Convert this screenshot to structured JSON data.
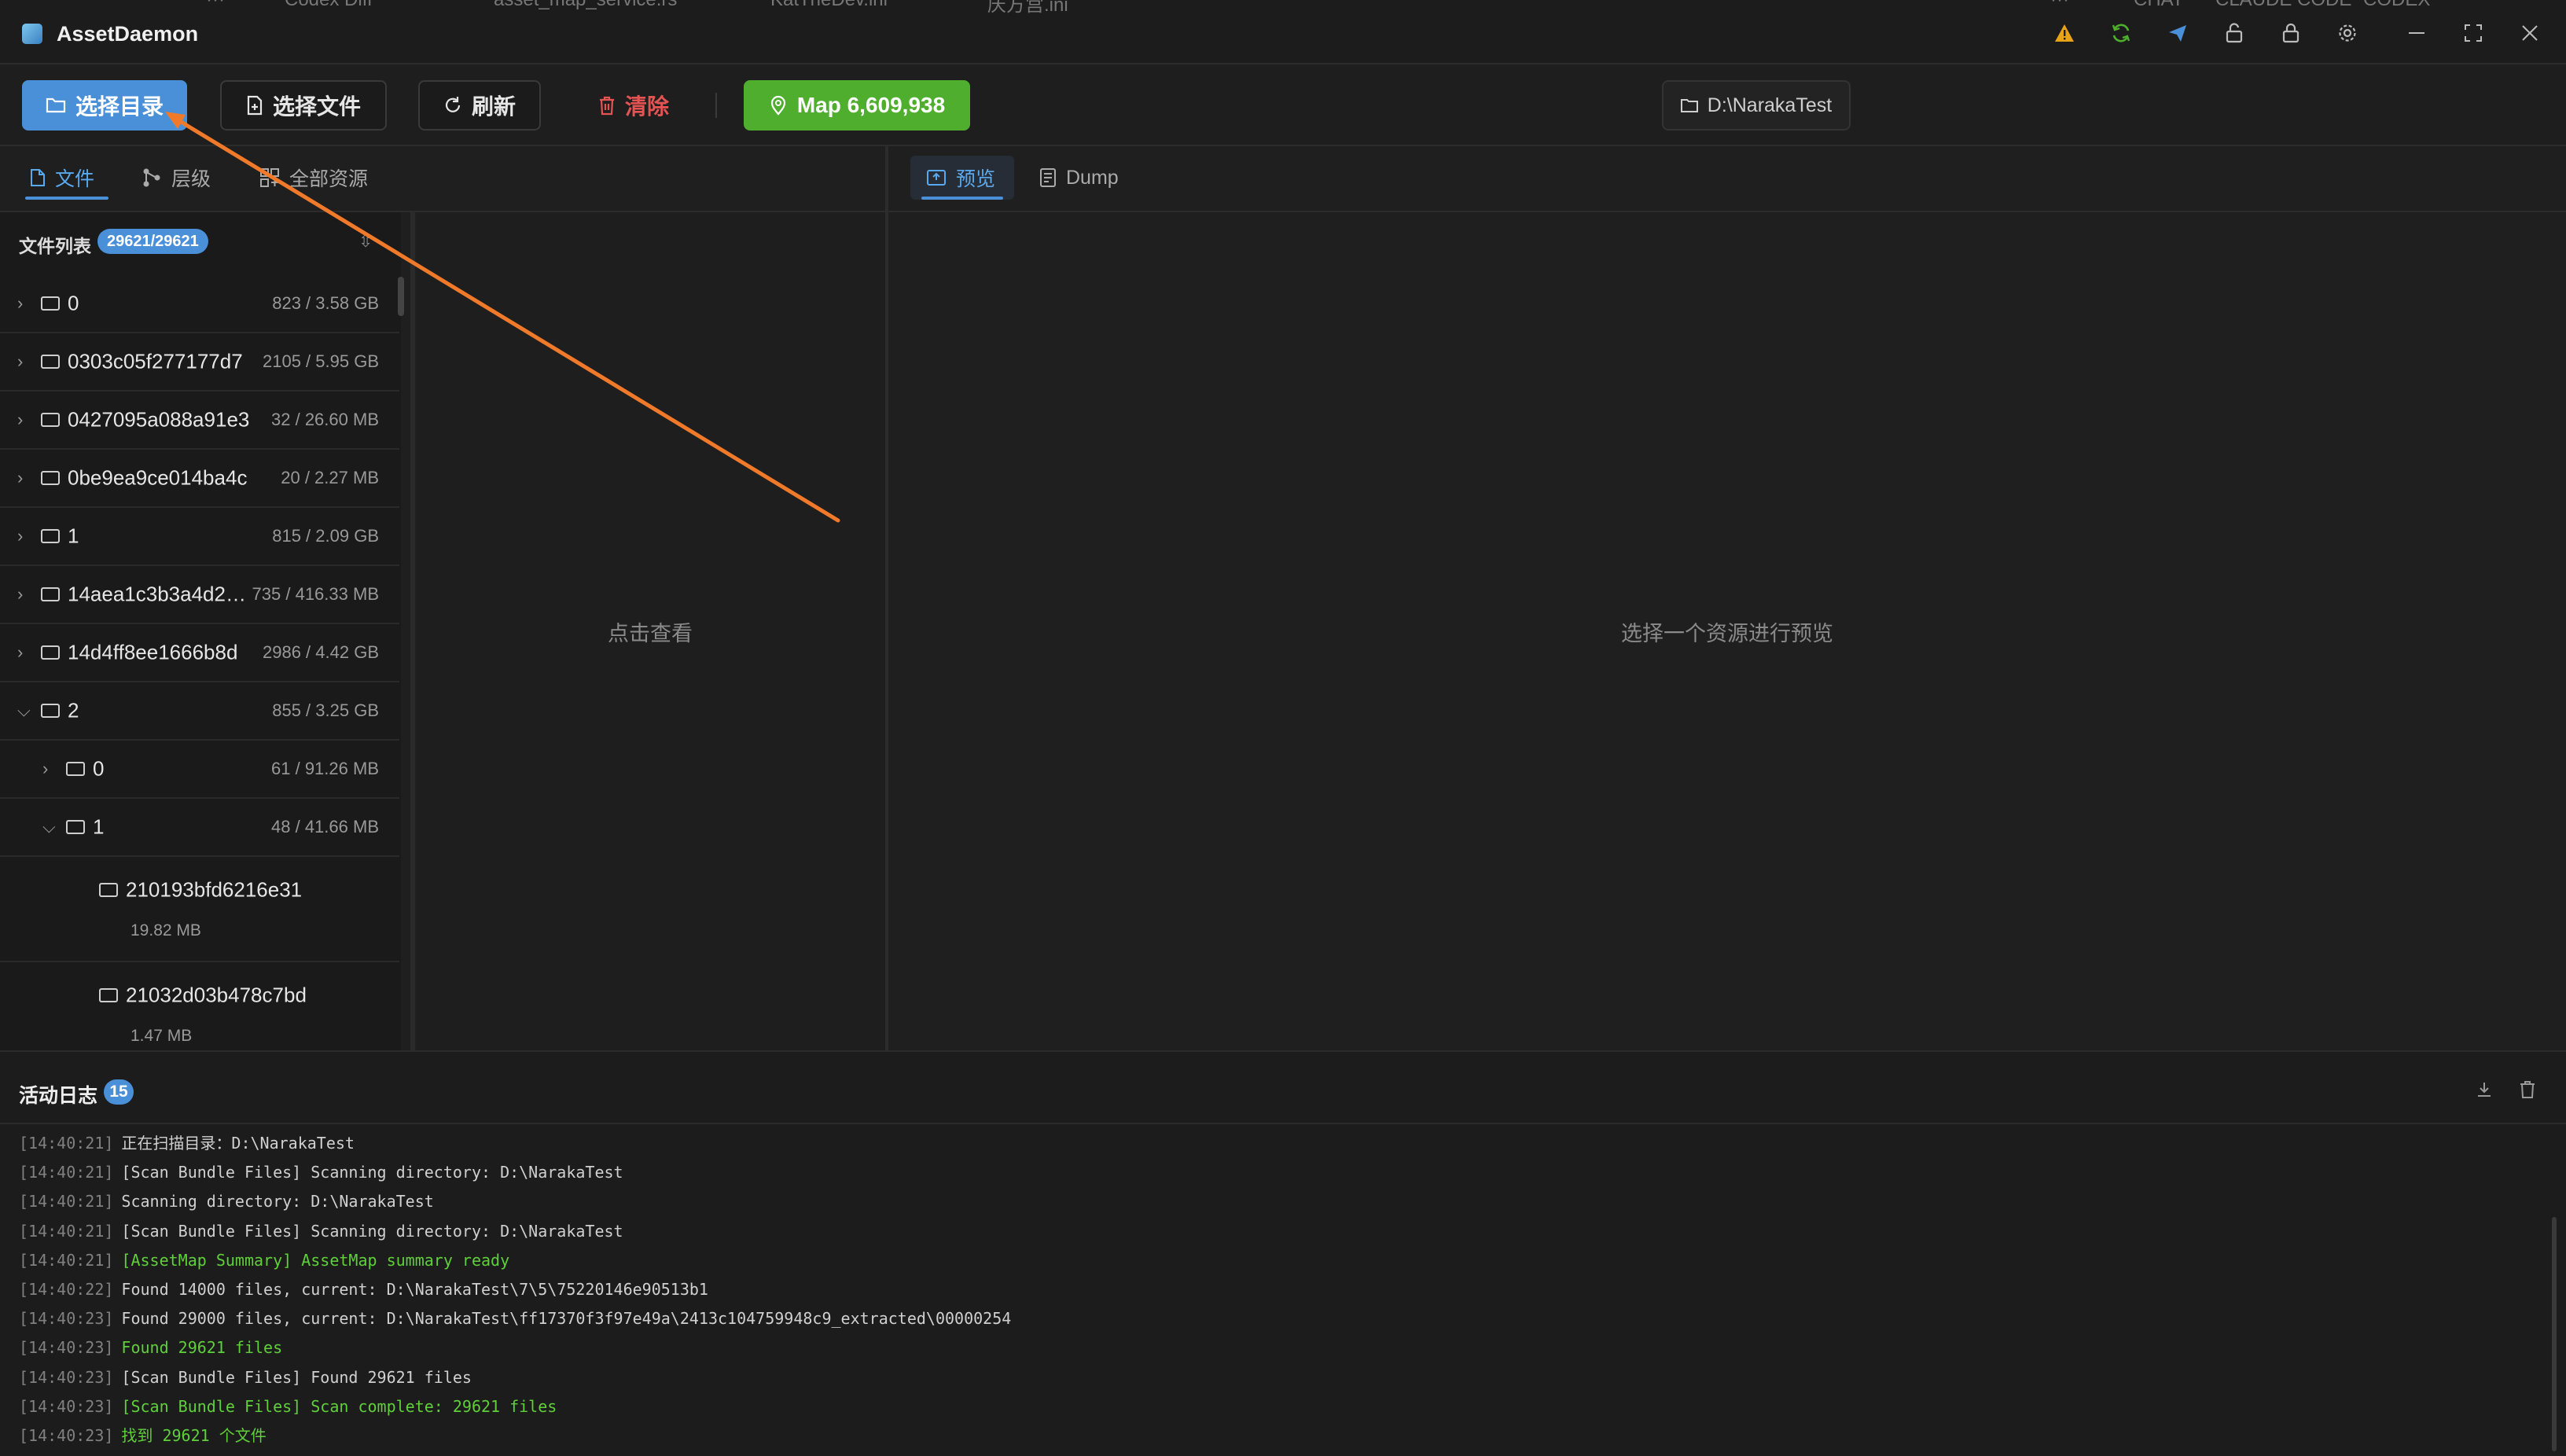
{
  "window": {
    "title": "AssetDaemon",
    "background_tabs": [
      "···",
      "Codex Diff",
      "asset_map_service.rs",
      "KatTheDev.ini",
      "庆方宫.ini",
      "···",
      "CHAT",
      "CLAUDE CODE",
      "CODEX"
    ]
  },
  "toolbar": {
    "select_dir": "选择目录",
    "select_file": "选择文件",
    "refresh": "刷新",
    "clear": "清除",
    "map": "Map 6,609,938",
    "path": "D:\\NarakaTest"
  },
  "left_tabs": [
    "文件",
    "层级",
    "全部资源"
  ],
  "file_list": {
    "header": "文件列表",
    "count": "29621/29621",
    "rows": [
      {
        "name": "0",
        "meta": "823 / 3.58 GB",
        "expanded": false,
        "level": 0
      },
      {
        "name": "0303c05f277177d7",
        "meta": "2105 / 5.95 GB",
        "expanded": false,
        "level": 0
      },
      {
        "name": "0427095a088a91e3",
        "meta": "32 / 26.60 MB",
        "expanded": false,
        "level": 0
      },
      {
        "name": "0be9ea9ce014ba4c",
        "meta": "20 / 2.27 MB",
        "expanded": false,
        "level": 0
      },
      {
        "name": "1",
        "meta": "815 / 2.09 GB",
        "expanded": false,
        "level": 0
      },
      {
        "name": "14aea1c3b3a4d2…",
        "meta": "735 / 416.33 MB",
        "expanded": false,
        "level": 0
      },
      {
        "name": "14d4ff8ee1666b8d",
        "meta": "2986 / 4.42 GB",
        "expanded": false,
        "level": 0
      },
      {
        "name": "2",
        "meta": "855 / 3.25 GB",
        "expanded": true,
        "level": 0
      },
      {
        "name": "0",
        "meta": "61 / 91.26 MB",
        "expanded": false,
        "level": 1
      },
      {
        "name": "1",
        "meta": "48 / 41.66 MB",
        "expanded": true,
        "level": 1
      }
    ],
    "leaf_rows": [
      {
        "name": "210193bfd6216e31",
        "size": "19.82 MB"
      },
      {
        "name": "21032d03b478c7bd",
        "size": "1.47 MB"
      }
    ]
  },
  "middle": {
    "hint": "点击查看"
  },
  "right_tabs": [
    "预览",
    "Dump"
  ],
  "right": {
    "hint": "选择一个资源进行预览"
  },
  "log": {
    "title": "活动日志",
    "count": "15",
    "lines": [
      {
        "ts": "[14:40:21]",
        "text": "正在扫描目录：D:\\NarakaTest",
        "success": false
      },
      {
        "ts": "[14:40:21]",
        "text": "[Scan Bundle Files] Scanning directory: D:\\NarakaTest",
        "success": false
      },
      {
        "ts": "[14:40:21]",
        "text": "Scanning directory: D:\\NarakaTest",
        "success": false
      },
      {
        "ts": "[14:40:21]",
        "text": "[Scan Bundle Files] Scanning directory: D:\\NarakaTest",
        "success": false
      },
      {
        "ts": "[14:40:21]",
        "text": "[AssetMap Summary] AssetMap summary ready",
        "success": true
      },
      {
        "ts": "[14:40:22]",
        "text": "Found 14000 files, current: D:\\NarakaTest\\7\\5\\75220146e90513b1",
        "success": false
      },
      {
        "ts": "[14:40:23]",
        "text": "Found 29000 files, current: D:\\NarakaTest\\ff17370f3f97e49a\\2413c104759948c9_extracted\\00000254",
        "success": false
      },
      {
        "ts": "[14:40:23]",
        "text": "Found 29621 files",
        "success": true
      },
      {
        "ts": "[14:40:23]",
        "text": "[Scan Bundle Files] Found 29621 files",
        "success": false
      },
      {
        "ts": "[14:40:23]",
        "text": "[Scan Bundle Files] Scan complete: 29621 files",
        "success": true
      },
      {
        "ts": "[14:40:23]",
        "text": "找到 29621 个文件",
        "success": true
      }
    ]
  },
  "colors": {
    "accent": "#4a90d9",
    "success": "#4fae2e",
    "danger": "#e65353",
    "annotation_arrow": "#f07a2a"
  }
}
